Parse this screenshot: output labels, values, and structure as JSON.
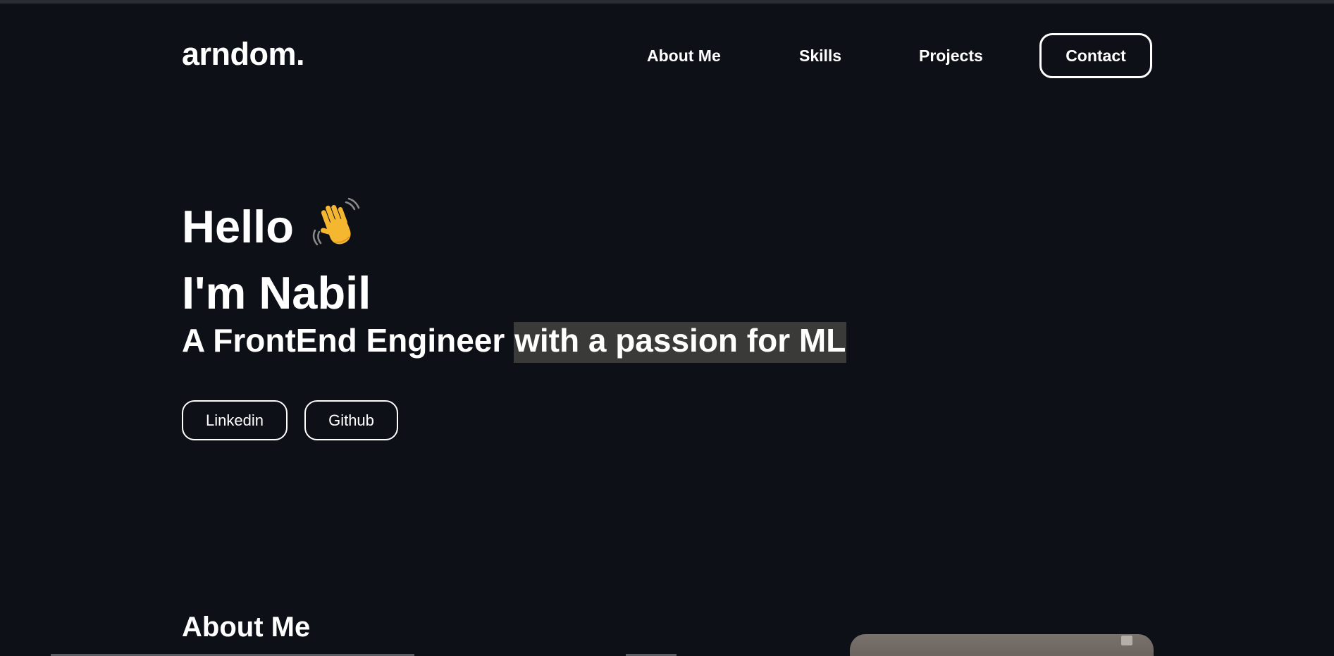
{
  "header": {
    "logo": "arndom.",
    "nav": {
      "about": "About Me",
      "skills": "Skills",
      "projects": "Projects",
      "contact": "Contact"
    }
  },
  "hero": {
    "greeting": "Hello",
    "greeting_icon": "waving-hand-icon",
    "name_line": "I'm Nabil",
    "tagline_plain": "A FrontEnd Engineer ",
    "tagline_highlight": "with a passion for ML",
    "buttons": {
      "linkedin": "Linkedin",
      "github": "Github"
    }
  },
  "about": {
    "heading": "About Me"
  },
  "colors": {
    "background": "#0d1017",
    "text": "#ffffff",
    "highlight": "#3a3a38"
  }
}
